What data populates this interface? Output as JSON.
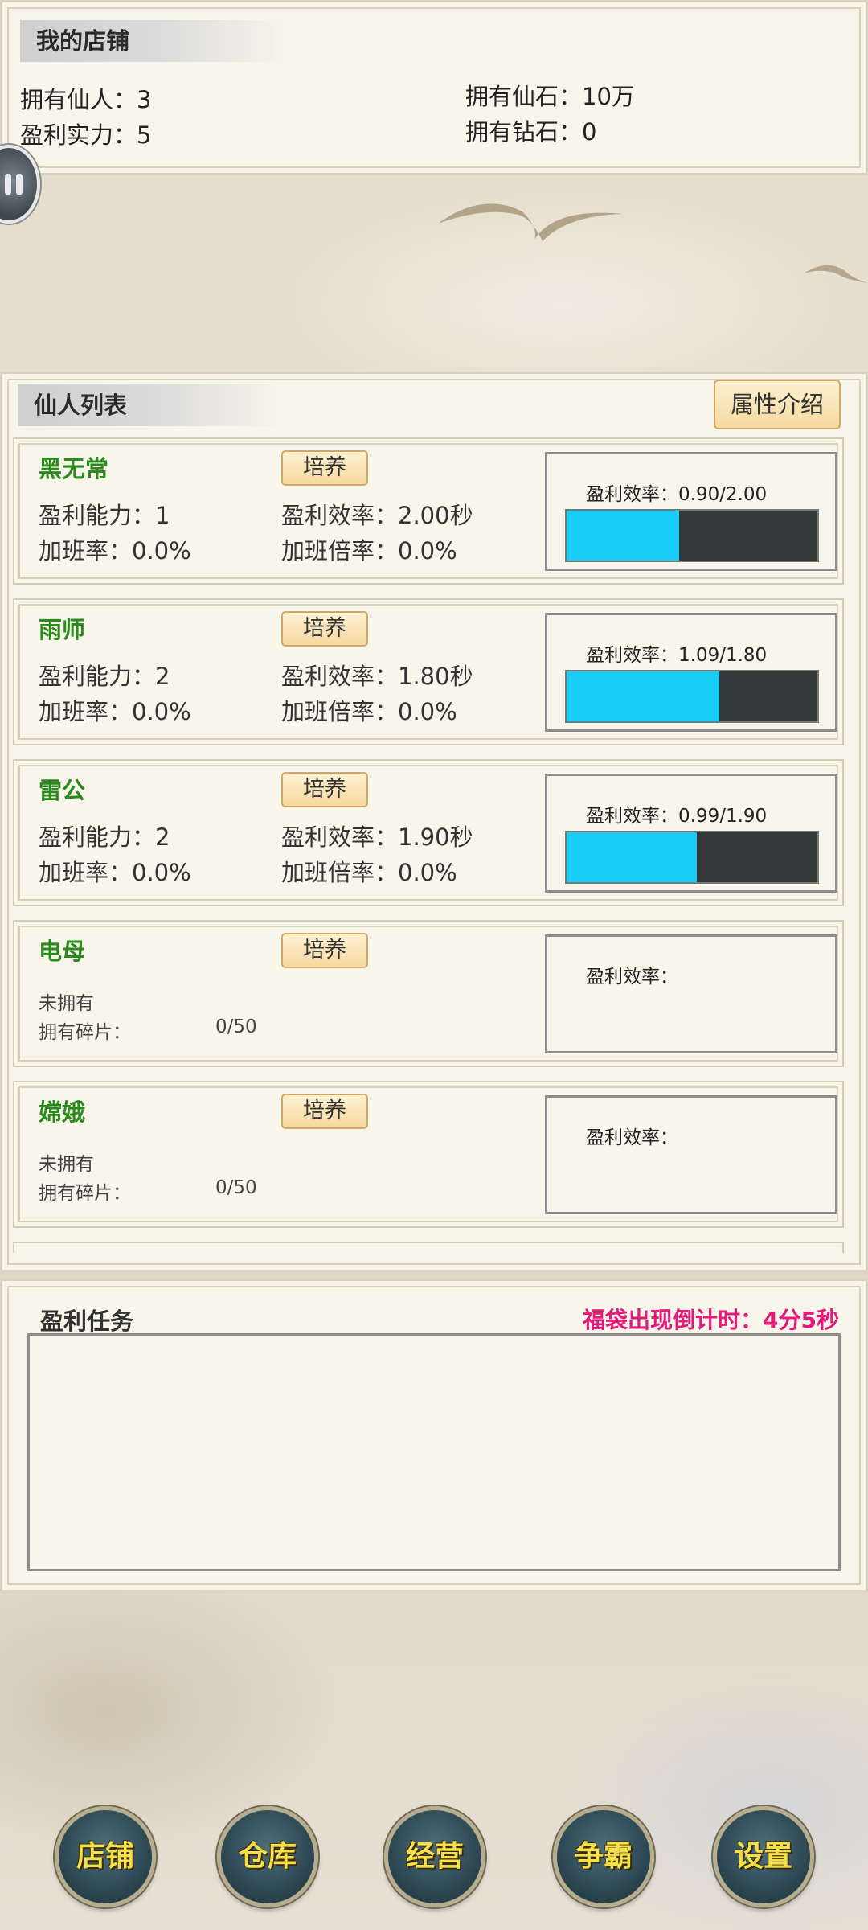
{
  "shop": {
    "title": "我的店铺",
    "immortals": "拥有仙人：3",
    "profit_power": "盈利实力：5",
    "stones": "拥有仙石：10万",
    "diamonds": "拥有钻石：0"
  },
  "immortal_list": {
    "title": "仙人列表",
    "attr_button": "属性介绍",
    "cards": [
      {
        "name": "黑无常",
        "train": "培养",
        "ability": "盈利能力：1",
        "efficiency": "盈利效率：2.00秒",
        "overtime_rate": "加班率：0.0%",
        "overtime_mult": "加班倍率：0.0%",
        "eff_label": "盈利效率：0.90/2.00",
        "progress": 0.45
      },
      {
        "name": "雨师",
        "train": "培养",
        "ability": "盈利能力：2",
        "efficiency": "盈利效率：1.80秒",
        "overtime_rate": "加班率：0.0%",
        "overtime_mult": "加班倍率：0.0%",
        "eff_label": "盈利效率：1.09/1.80",
        "progress": 0.61
      },
      {
        "name": "雷公",
        "train": "培养",
        "ability": "盈利能力：2",
        "efficiency": "盈利效率：1.90秒",
        "overtime_rate": "加班率：0.0%",
        "overtime_mult": "加班倍率：0.0%",
        "eff_label": "盈利效率：0.99/1.90",
        "progress": 0.52
      },
      {
        "name": "电母",
        "train": "培养",
        "status": "未拥有",
        "fragments_label": "拥有碎片：",
        "fragments_value": "0/50",
        "eff_label": "盈利效率："
      },
      {
        "name": "嫦娥",
        "train": "培养",
        "status": "未拥有",
        "fragments_label": "拥有碎片：",
        "fragments_value": "0/50",
        "eff_label": "盈利效率："
      }
    ]
  },
  "tasks": {
    "title": "盈利任务",
    "countdown": "福袋出现倒计时：4分5秒"
  },
  "nav": [
    "店铺",
    "仓库",
    "经营",
    "争霸",
    "设置"
  ],
  "colors": {
    "name_green": "#2a8a1c",
    "bar_fill": "#18cdf5",
    "countdown_pink": "#e6197b",
    "nav_text": "#f4e04a"
  }
}
